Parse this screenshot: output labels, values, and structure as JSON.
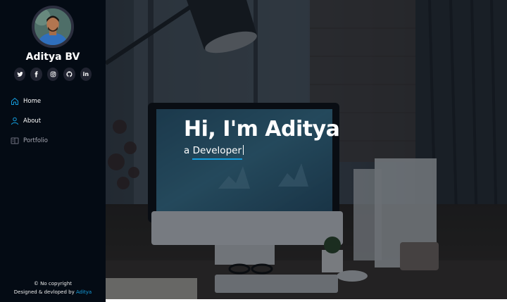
{
  "profile": {
    "name": "Aditya BV"
  },
  "socials": [
    {
      "icon": "twitter-icon"
    },
    {
      "icon": "facebook-icon"
    },
    {
      "icon": "instagram-icon"
    },
    {
      "icon": "github-icon"
    },
    {
      "icon": "linkedin-icon",
      "label": "in"
    }
  ],
  "nav": {
    "items": [
      {
        "label": "Home",
        "icon": "home-icon",
        "active": true
      },
      {
        "label": "About",
        "icon": "user-icon",
        "active": false
      },
      {
        "label": "Portfolio",
        "icon": "book-icon",
        "active": false
      }
    ]
  },
  "footer": {
    "copyright": "© No copyright",
    "credit_prefix": "Designed & devloped by",
    "credit_link": "Aditya"
  },
  "hero": {
    "title": "Hi, I'm Aditya",
    "subtitle": "a Developer"
  },
  "colors": {
    "accent": "#149ddd",
    "sidebar_bg": "#040b14",
    "social_bg": "#212431"
  }
}
